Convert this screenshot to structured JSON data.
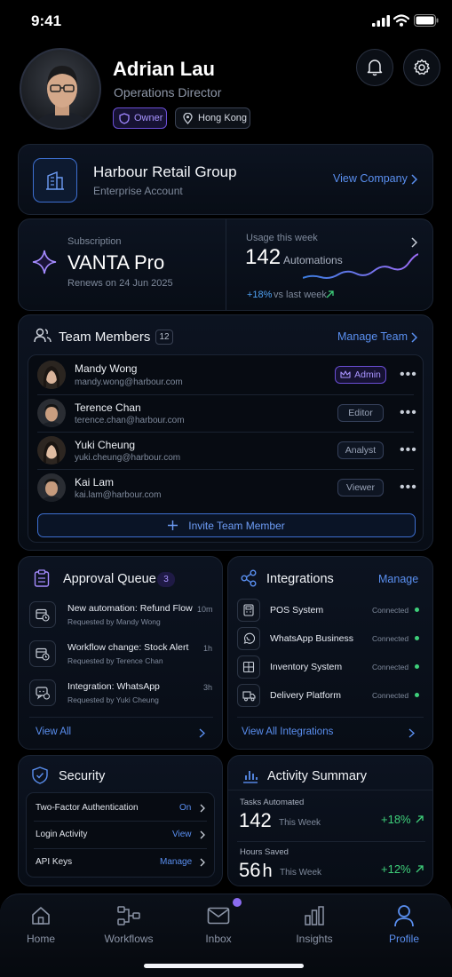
{
  "status_bar": {
    "time": "9:41"
  },
  "profile": {
    "name": "Adrian Lau",
    "role": "Operations Director",
    "badge_role": "Owner",
    "location": "Hong Kong"
  },
  "company": {
    "name": "Harbour Retail Group",
    "account_type": "Enterprise Account",
    "link": "View Company"
  },
  "subscription": {
    "label": "Subscription",
    "plan": "VANTA Pro",
    "renews": "Renews on 24 Jun 2025"
  },
  "usage": {
    "label": "Usage this week",
    "count": "142",
    "unit": "Automations",
    "change": "+18%",
    "change_suffix": "vs last week"
  },
  "team": {
    "title": "Team Members",
    "count": "12",
    "manage": "Manage Team",
    "members": [
      {
        "name": "Mandy Wong",
        "email": "mandy.wong@harbour.com",
        "role": "Admin"
      },
      {
        "name": "Terence Chan",
        "email": "terence.chan@harbour.com",
        "role": "Editor"
      },
      {
        "name": "Yuki Cheung",
        "email": "yuki.cheung@harbour.com",
        "role": "Analyst"
      },
      {
        "name": "Kai Lam",
        "email": "kai.lam@harbour.com",
        "role": "Viewer"
      }
    ],
    "invite": "Invite Team Member"
  },
  "approval": {
    "title": "Approval Queue",
    "count": "3",
    "items": [
      {
        "title": "New automation: Refund Flow",
        "sub": "Requested by Mandy Wong",
        "time": "10m"
      },
      {
        "title": "Workflow change: Stock Alert",
        "sub": "Requested by Terence Chan",
        "time": "1h"
      },
      {
        "title": "Integration: WhatsApp",
        "sub": "Requested by Yuki Cheung",
        "time": "3h"
      }
    ],
    "view_all": "View All"
  },
  "integrations": {
    "title": "Integrations",
    "manage": "Manage",
    "items": [
      {
        "name": "POS System",
        "status": "Connected"
      },
      {
        "name": "WhatsApp Business",
        "status": "Connected"
      },
      {
        "name": "Inventory System",
        "status": "Connected"
      },
      {
        "name": "Delivery Platform",
        "status": "Connected"
      }
    ],
    "view_all": "View All Integrations"
  },
  "security": {
    "title": "Security",
    "items": [
      {
        "label": "Two-Factor Authentication",
        "value": "On"
      },
      {
        "label": "Login Activity",
        "value": "View"
      },
      {
        "label": "API Keys",
        "value": "Manage"
      }
    ]
  },
  "activity": {
    "title": "Activity Summary",
    "tasks_label": "Tasks Automated",
    "tasks_value": "142",
    "tasks_period": "This Week",
    "tasks_change": "+18%",
    "hours_label": "Hours Saved",
    "hours_value": "56",
    "hours_unit": "h",
    "hours_period": "This Week",
    "hours_change": "+12%"
  },
  "nav": {
    "tabs": [
      {
        "label": "Home"
      },
      {
        "label": "Workflows"
      },
      {
        "label": "Inbox"
      },
      {
        "label": "Insights"
      },
      {
        "label": "Profile"
      }
    ]
  },
  "colors": {
    "accent": "#5a8ff0",
    "purple": "#8b6cf0",
    "positive": "#3ecf7a",
    "background": "#000000"
  }
}
